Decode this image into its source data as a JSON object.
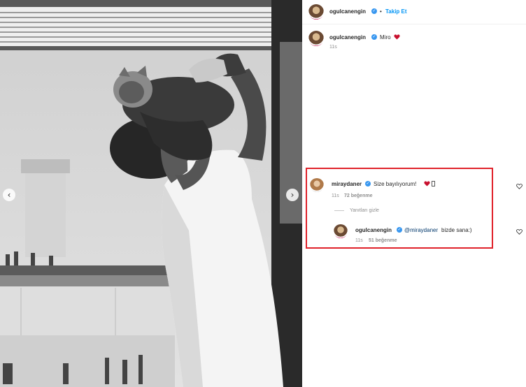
{
  "post": {
    "author": "ogulcanengin",
    "follow_label": "Takip Et",
    "separator": "•",
    "caption_user": "ogulcanengin",
    "caption_text": "Miro",
    "caption_time": "11s"
  },
  "comments": [
    {
      "user": "miraydaner",
      "text": "Size bayılıyorum!",
      "time": "11s",
      "likes": "72 beğenme",
      "hide_replies": "Yanıtları gizle"
    },
    {
      "user": "ogulcanengin",
      "mention": "@miraydaner",
      "text": "bizde sana:)",
      "time": "11s",
      "likes": "51 beğenme"
    }
  ],
  "colors": {
    "accent_blue": "#0095f6",
    "verified_blue": "#3897f0",
    "heart_red": "#ed4956",
    "highlight_red": "#e0222a"
  },
  "icons": [
    "verified-badge-icon",
    "heart-emoji-icon",
    "like-heart-icon",
    "carousel-prev-icon",
    "carousel-next-icon"
  ]
}
